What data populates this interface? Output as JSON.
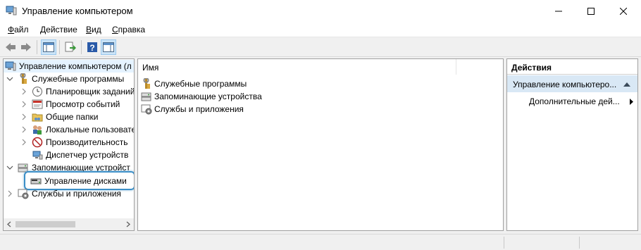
{
  "window": {
    "title": "Управление компьютером",
    "controls": {
      "minimize": "minimize-icon",
      "maximize": "maximize-icon",
      "close": "close-icon"
    }
  },
  "menu": [
    {
      "label": "Файл",
      "accel": "Ф",
      "rest": "айл"
    },
    {
      "label": "Действие",
      "accel": "Д",
      "rest": "ействие"
    },
    {
      "label": "Вид",
      "accel": "В",
      "rest": "ид"
    },
    {
      "label": "Справка",
      "accel": "С",
      "rest": "правка"
    }
  ],
  "tree": {
    "root": "Управление компьютером (л",
    "system_tools": "Служебные программы",
    "task_scheduler": "Планировщик заданий",
    "event_viewer": "Просмотр событий",
    "shared_folders": "Общие папки",
    "local_users": "Локальные пользовате",
    "performance": "Производительность",
    "device_manager": "Диспетчер устройств",
    "storage": "Запоминающие устройст",
    "disk_management": "Управление дисками",
    "services_apps": "Службы и приложения"
  },
  "list": {
    "column_name": "Имя",
    "items": [
      "Служебные программы",
      "Запоминающие устройства",
      "Службы и приложения"
    ]
  },
  "actions": {
    "header": "Действия",
    "section": "Управление компьютеро...",
    "more": "Дополнительные дей..."
  },
  "colors": {
    "selection": "#e5f3ff",
    "accent": "#3c8fc7",
    "action_section": "#d9e8f5"
  }
}
